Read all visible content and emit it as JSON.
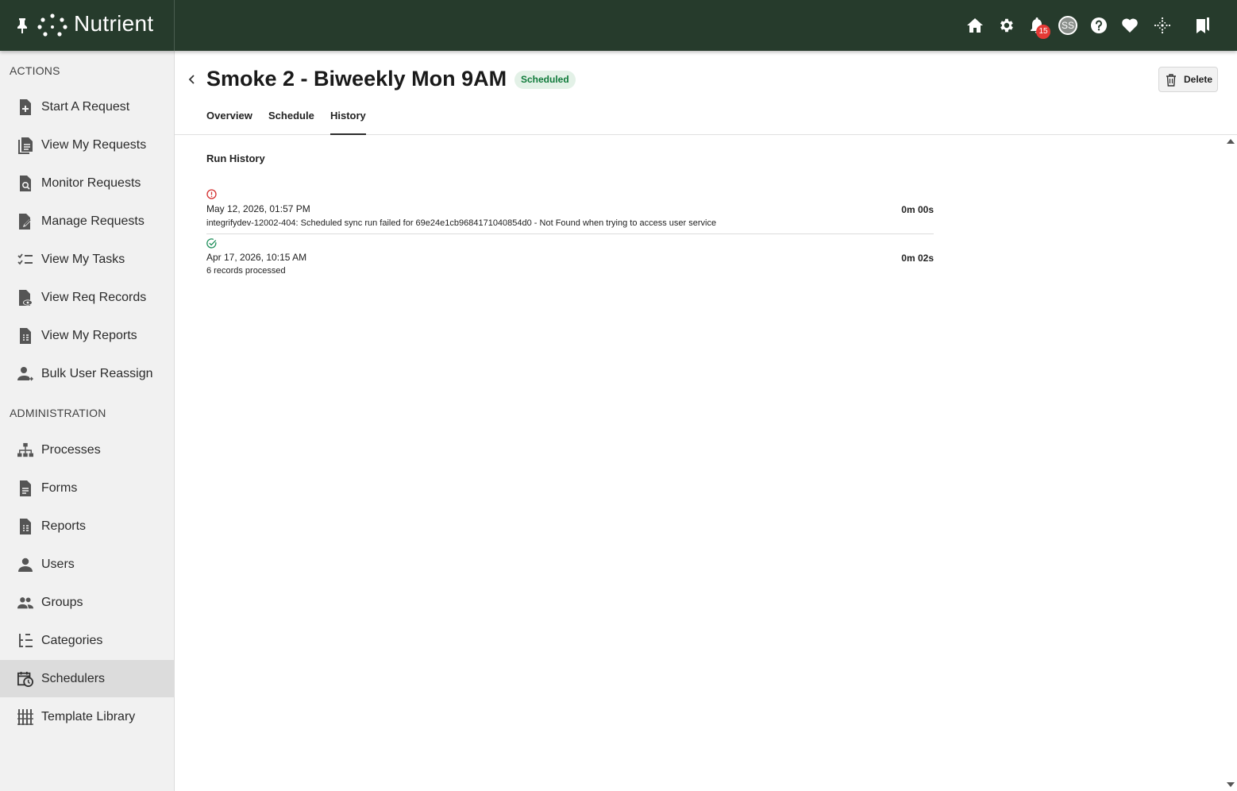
{
  "brand": {
    "name": "Nutrient"
  },
  "header": {
    "notification_count": "15",
    "avatar_initials": "SS",
    "icons": [
      "pin-icon",
      "home-icon",
      "gear-icon",
      "bell-icon",
      "help-icon",
      "heart-icon",
      "sparkle-icon",
      "bookmarks-icon"
    ]
  },
  "sidebar": {
    "actions_title": "ACTIONS",
    "actions": [
      {
        "label": "Start A Request",
        "icon": "file-plus-icon"
      },
      {
        "label": "View My Requests",
        "icon": "files-icon"
      },
      {
        "label": "Monitor Requests",
        "icon": "file-search-icon"
      },
      {
        "label": "Manage Requests",
        "icon": "file-edit-icon"
      },
      {
        "label": "View My Tasks",
        "icon": "checklist-icon"
      },
      {
        "label": "View Req Records",
        "icon": "file-eye-icon"
      },
      {
        "label": "View My Reports",
        "icon": "report-icon"
      },
      {
        "label": "Bulk User Reassign",
        "icon": "user-reassign-icon"
      }
    ],
    "admin_title": "ADMINISTRATION",
    "admin": [
      {
        "label": "Processes",
        "icon": "hierarchy-icon"
      },
      {
        "label": "Forms",
        "icon": "form-icon"
      },
      {
        "label": "Reports",
        "icon": "report-icon"
      },
      {
        "label": "Users",
        "icon": "user-icon"
      },
      {
        "label": "Groups",
        "icon": "group-icon"
      },
      {
        "label": "Categories",
        "icon": "tree-icon"
      },
      {
        "label": "Schedulers",
        "icon": "calendar-clock-icon",
        "active": true
      },
      {
        "label": "Template Library",
        "icon": "library-icon"
      }
    ]
  },
  "page": {
    "title": "Smoke 2 - Biweekly Mon 9AM",
    "status": "Scheduled",
    "delete_label": "Delete",
    "tabs": [
      "Overview",
      "Schedule",
      "History"
    ],
    "active_tab": "History"
  },
  "history": {
    "title": "Run History",
    "runs": [
      {
        "status": "error",
        "date": "May 12, 2026, 01:57 PM",
        "duration": "0m 00s",
        "message": "integrifydev-12002-404: Scheduled sync run failed for 69e24e1cb9684171040854d0 - Not Found when trying to access user service"
      },
      {
        "status": "success",
        "date": "Apr 17, 2026, 10:15 AM",
        "duration": "0m 02s",
        "message": "6 records processed"
      }
    ]
  },
  "colors": {
    "topbar": "#263b2c",
    "badge_bg": "#e3f1e7",
    "badge_text": "#0f7a3a",
    "error": "#d32f2f",
    "success": "#1e8e5a",
    "notification": "#e53935"
  }
}
